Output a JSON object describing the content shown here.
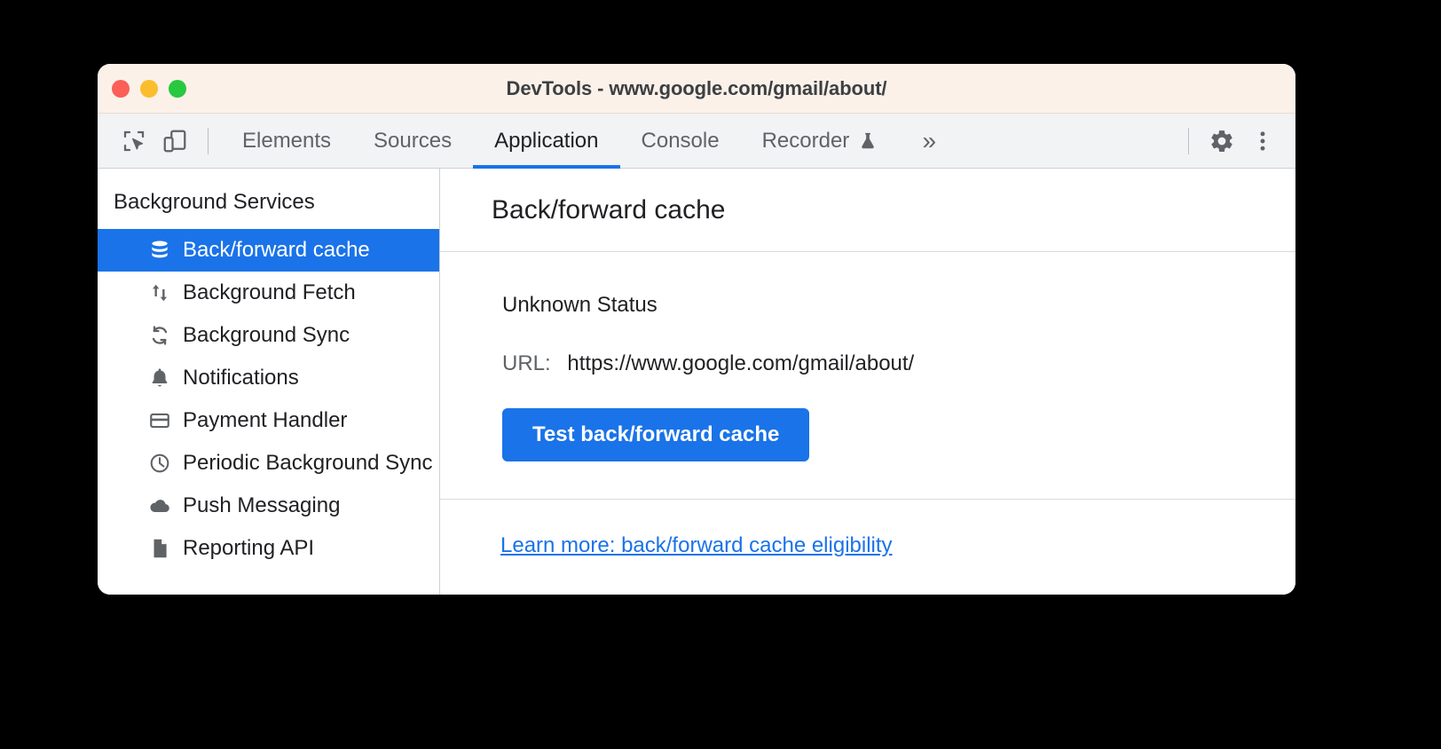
{
  "window": {
    "title": "DevTools - www.google.com/gmail/about/",
    "traffic_lights": [
      {
        "name": "close",
        "color": "#fb5f57"
      },
      {
        "name": "minimize",
        "color": "#fabd2e"
      },
      {
        "name": "maximize",
        "color": "#28c840"
      }
    ]
  },
  "toolbar": {
    "inspect_icon": "inspect-element-icon",
    "device_icon": "device-toolbar-icon",
    "more_tabs_label": "»",
    "settings_icon": "gear-icon",
    "menu_icon": "kebab-menu-icon",
    "tabs": [
      {
        "label": "Elements",
        "active": false,
        "experiment": false
      },
      {
        "label": "Sources",
        "active": false,
        "experiment": false
      },
      {
        "label": "Application",
        "active": true,
        "experiment": false
      },
      {
        "label": "Console",
        "active": false,
        "experiment": false
      },
      {
        "label": "Recorder",
        "active": false,
        "experiment": true
      }
    ]
  },
  "sidebar": {
    "heading": "Background Services",
    "items": [
      {
        "label": "Back/forward cache",
        "icon": "database-icon",
        "selected": true
      },
      {
        "label": "Background Fetch",
        "icon": "up-down-arrows-icon",
        "selected": false
      },
      {
        "label": "Background Sync",
        "icon": "sync-icon",
        "selected": false
      },
      {
        "label": "Notifications",
        "icon": "bell-icon",
        "selected": false
      },
      {
        "label": "Payment Handler",
        "icon": "credit-card-icon",
        "selected": false
      },
      {
        "label": "Periodic Background Sync",
        "icon": "clock-icon",
        "selected": false
      },
      {
        "label": "Push Messaging",
        "icon": "cloud-icon",
        "selected": false
      },
      {
        "label": "Reporting API",
        "icon": "document-icon",
        "selected": false
      }
    ]
  },
  "main": {
    "title": "Back/forward cache",
    "status": "Unknown Status",
    "url_label": "URL:",
    "url_value": "https://www.google.com/gmail/about/",
    "test_button": "Test back/forward cache",
    "learn_more_link": "Learn more: back/forward cache eligibility"
  },
  "colors": {
    "accent": "#1a73e8",
    "titlebar_bg": "#fcf1e9",
    "toolbar_bg": "#f1f3f4",
    "text": "#202124",
    "muted_text": "#5f6368"
  }
}
